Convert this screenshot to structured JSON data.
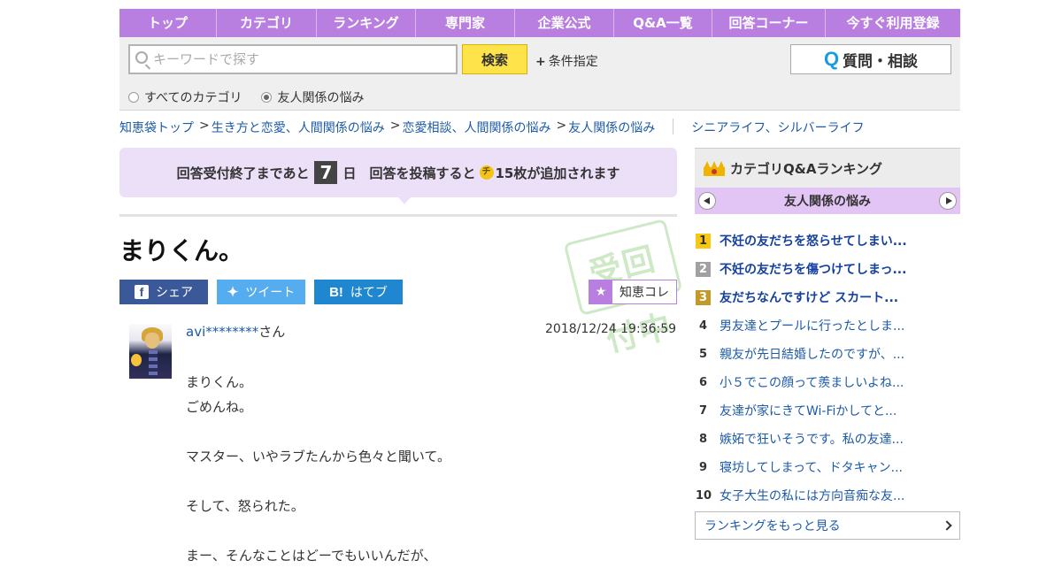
{
  "nav": [
    "トップ",
    "カテゴリ",
    "ランキング",
    "専門家",
    "企業公式",
    "Q&A一覧",
    "回答コーナー",
    "今すぐ利用登録"
  ],
  "search": {
    "placeholder": "キーワードで探す",
    "button": "検索",
    "condition": "条件指定",
    "ask_button": "質問・相談",
    "ask_icon": "Q",
    "radio_all": "すべてのカテゴリ",
    "radio_current": "友人関係の悩み"
  },
  "breadcrumb": {
    "items": [
      "知恵袋トップ",
      "生き方と恋愛、人間関係の悩み",
      "恋愛相談、人間関係の悩み",
      "友人関係の悩み"
    ],
    "related": "シニアライフ、シルバーライフ"
  },
  "notice": {
    "part1": "回答受付終了まであと",
    "days": "7",
    "part2": "日　回答を投稿すると",
    "coin": "チ",
    "part3": "15枚が追加されます"
  },
  "question": {
    "title": "まりくん。",
    "stamp": "受回付中",
    "share_fb": "シェア",
    "share_tw": "ツイート",
    "share_hb": "はてブ",
    "share_hb_icon": "B!",
    "chie_btn": "知恵コレ",
    "user_name": "avi********",
    "user_suffix": "さん",
    "date": "2018/12/24  19:36:59",
    "body": [
      "まりくん。",
      "ごめんね。",
      "",
      "マスター、いやラブたんから色々と聞いて。",
      "",
      "そして、怒られた。",
      "",
      "まー、そんなことはどーでもいいんだが、"
    ]
  },
  "ranking": {
    "title": "カテゴリQ&Aランキング",
    "category": "友人関係の悩み",
    "items": [
      {
        "no": "1",
        "text": "不妊の友だちを怒らせてしまい..."
      },
      {
        "no": "2",
        "text": "不妊の友だちを傷つけてしまっ..."
      },
      {
        "no": "3",
        "text": "友だちなんですけど スカート..."
      },
      {
        "no": "4",
        "text": "男友達とプールに行ったとしま..."
      },
      {
        "no": "5",
        "text": "親友が先日結婚したのですが、..."
      },
      {
        "no": "6",
        "text": "小５でこの顔って羨ましいよね..."
      },
      {
        "no": "7",
        "text": "友達が家にきてWi-Fiかしてと..."
      },
      {
        "no": "8",
        "text": "嫉妬で狂いそうです。私の友達..."
      },
      {
        "no": "9",
        "text": "寝坊してしまって、ドタキャン..."
      },
      {
        "no": "10",
        "text": "女子大生の私には方向音痴な友..."
      }
    ],
    "more": "ランキングをもっと見る"
  },
  "colors": {
    "nav": "#b97fe0",
    "notice": "#ecdff8",
    "search_btn": "#ffe34a",
    "link": "#1d5aa8"
  }
}
